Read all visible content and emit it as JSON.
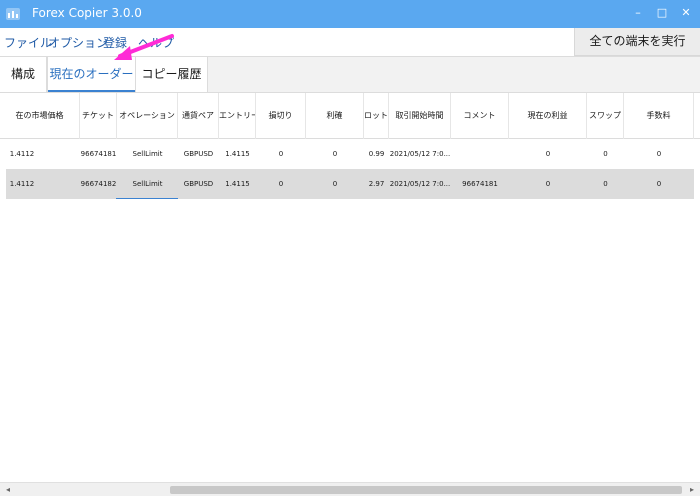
{
  "window": {
    "title": "Forex Copier 3.0.0",
    "icon": "app-icon",
    "minimize": "–",
    "maximize": "□",
    "close": "✕",
    "accent": "#5aa8f0"
  },
  "menu": [
    {
      "label": "ファイル"
    },
    {
      "label": "オプション"
    },
    {
      "label": "登録"
    },
    {
      "label": "ヘルプ"
    }
  ],
  "toolbar": {
    "execute_all_label": "全ての端末を実行"
  },
  "tabs": [
    {
      "label": "構成",
      "active": false
    },
    {
      "label": "現在のオーダー",
      "active": true
    },
    {
      "label": "コピー履歴",
      "active": false
    }
  ],
  "annotation": {
    "arrow_color": "#ff2bd6"
  },
  "table": {
    "columns": [
      "在の市場価格",
      "チケット",
      "オペレーション",
      "通貨ペア",
      "エントリー",
      "損切り",
      "利確",
      "ロット",
      "取引開始時間",
      "コメント",
      "現在の利益",
      "スワップ",
      "手数料"
    ],
    "rows": [
      [
        "1.4112",
        "96674181",
        "SellLimit",
        "GBPUSD",
        "1.4115",
        "0",
        "0",
        "0.99",
        "2021/05/12 7:0...",
        "",
        "0",
        "0",
        "0"
      ],
      [
        "1.4112",
        "96674182",
        "SellLimit",
        "GBPUSD",
        "1.4115",
        "0",
        "0",
        "2.97",
        "2021/05/12 7:0...",
        "96674181",
        "0",
        "0",
        "0"
      ]
    ],
    "selected_row": 1
  },
  "scrollbar": {
    "left_arrow": "◂",
    "right_arrow": "▸"
  }
}
